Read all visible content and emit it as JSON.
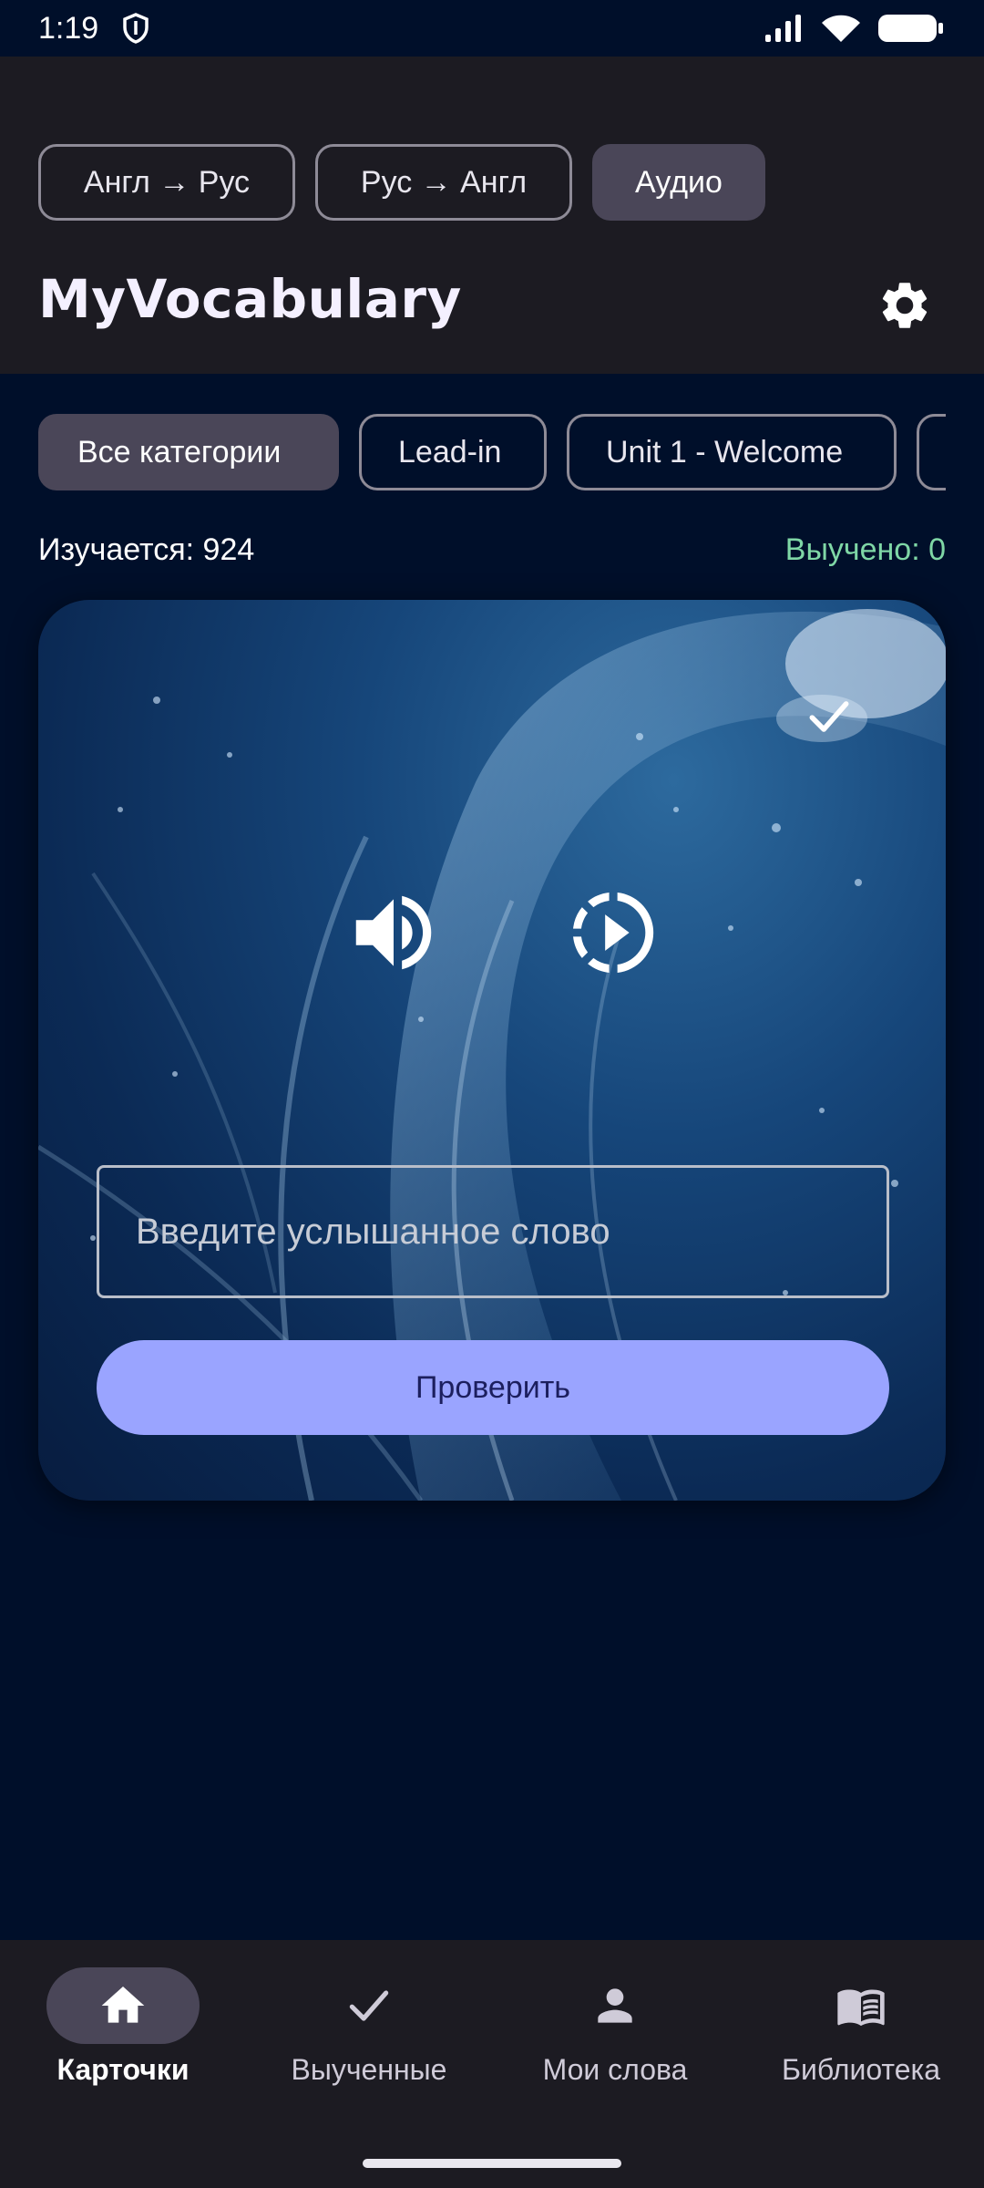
{
  "status_bar": {
    "time": "1:19",
    "icons": [
      "shield-icon",
      "signal-icon",
      "wifi-icon",
      "battery-icon"
    ]
  },
  "header": {
    "mode_tabs": [
      {
        "label": "Англ → Рус",
        "selected": false
      },
      {
        "label": "Рус → Англ",
        "selected": false
      },
      {
        "label": "Аудио",
        "selected": true
      }
    ],
    "title": "MyVocabulary",
    "settings_icon": "gear-icon"
  },
  "categories": [
    {
      "label": "Все категории",
      "selected": true
    },
    {
      "label": "Lead-in",
      "selected": false
    },
    {
      "label": "Unit 1 - Welcome",
      "selected": false
    },
    {
      "label": "",
      "selected": false
    }
  ],
  "stats": {
    "learning": "Изучается: 924",
    "learned": "Выучено: 0"
  },
  "card": {
    "icons": [
      "check-icon",
      "speaker-icon",
      "slow-play-icon"
    ],
    "input_placeholder": "Введите услышанное слово",
    "input_value": "",
    "check_button": "Проверить"
  },
  "bottom_nav": [
    {
      "label": "Карточки",
      "icon": "home-icon",
      "active": true
    },
    {
      "label": "Выученные",
      "icon": "check-icon",
      "active": false
    },
    {
      "label": "Мои слова",
      "icon": "person-icon",
      "active": false
    },
    {
      "label": "Библиотека",
      "icon": "book-icon",
      "active": false
    }
  ],
  "colors": {
    "background": "#000f2a",
    "surface": "#1c1b22",
    "chip_selected": "#4a4658",
    "accent_button": "#9aa4ff",
    "learned_text": "#7fd7a6"
  }
}
